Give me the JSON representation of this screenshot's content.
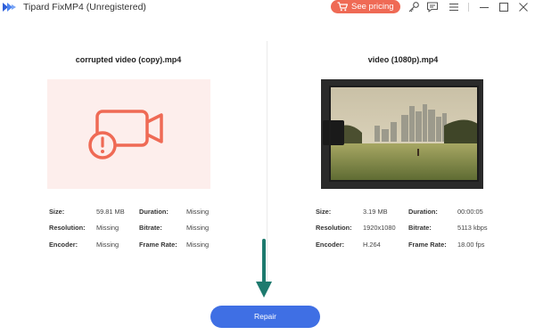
{
  "window": {
    "title": "Tipard FixMP4 (Unregistered)",
    "pricing_label": "See pricing"
  },
  "left": {
    "filename": "corrupted video (copy).mp4",
    "info": {
      "size_label": "Size:",
      "size": "59.81 MB",
      "duration_label": "Duration:",
      "duration": "Missing",
      "resolution_label": "Resolution:",
      "resolution": "Missing",
      "bitrate_label": "Bitrate:",
      "bitrate": "Missing",
      "encoder_label": "Encoder:",
      "encoder": "Missing",
      "framerate_label": "Frame Rate:",
      "framerate": "Missing"
    }
  },
  "right": {
    "filename": "video (1080p).mp4",
    "info": {
      "size_label": "Size:",
      "size": "3.19 MB",
      "duration_label": "Duration:",
      "duration": "00:00:05",
      "resolution_label": "Resolution:",
      "resolution": "1920x1080",
      "bitrate_label": "Bitrate:",
      "bitrate": "5113 kbps",
      "encoder_label": "Encoder:",
      "encoder": "H.264",
      "framerate_label": "Frame Rate:",
      "framerate": "18.00 fps"
    }
  },
  "repair_label": "Repair",
  "colors": {
    "accent": "#3f6fe4",
    "pricing": "#ef6a55",
    "error_icon": "#ef6a55",
    "arrow": "#1d7a6e"
  },
  "icons": [
    "app-logo-icon",
    "cart-icon",
    "key-icon",
    "chat-icon",
    "menu-icon",
    "minimize-icon",
    "maximize-icon",
    "close-icon",
    "video-error-icon",
    "down-arrow-icon"
  ]
}
